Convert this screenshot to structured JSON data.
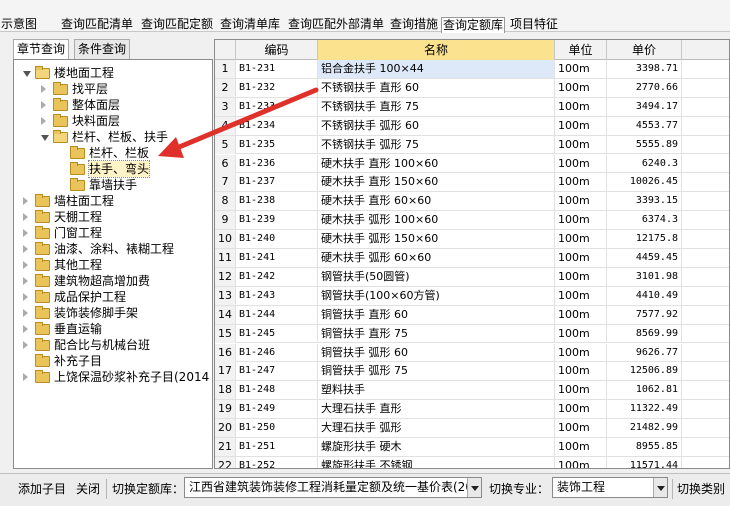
{
  "top_tabs": [
    "示意图",
    "查询匹配清单",
    "查询匹配定额",
    "查询清单库",
    "查询匹配外部清单",
    "查询措施",
    "查询定额库",
    "项目特征"
  ],
  "left_tabs": [
    "章节查询",
    "条件查询"
  ],
  "tree": [
    {
      "label": "楼地面工程",
      "state": "open",
      "level": 0
    },
    {
      "label": "找平层",
      "state": "closed",
      "level": 1
    },
    {
      "label": "整体面层",
      "state": "closed",
      "level": 1
    },
    {
      "label": "块料面层",
      "state": "closed",
      "level": 1
    },
    {
      "label": "栏杆、栏板、扶手",
      "state": "open",
      "level": 1
    },
    {
      "label": "栏杆、栏板",
      "state": "leaf",
      "level": 2
    },
    {
      "label": "扶手、弯头",
      "state": "leaf",
      "level": 2
    },
    {
      "label": "靠墙扶手",
      "state": "leaf",
      "level": 2
    },
    {
      "label": "墙柱面工程",
      "state": "closed",
      "level": 0
    },
    {
      "label": "天棚工程",
      "state": "closed",
      "level": 0
    },
    {
      "label": "门窗工程",
      "state": "closed",
      "level": 0
    },
    {
      "label": "油漆、涂料、裱糊工程",
      "state": "closed",
      "level": 0
    },
    {
      "label": "其他工程",
      "state": "closed",
      "level": 0
    },
    {
      "label": "建筑物超高增加费",
      "state": "closed",
      "level": 0
    },
    {
      "label": "成品保护工程",
      "state": "closed",
      "level": 0
    },
    {
      "label": "装饰装修脚手架",
      "state": "closed",
      "level": 0
    },
    {
      "label": "垂直运输",
      "state": "closed",
      "level": 0
    },
    {
      "label": "配合比与机械台班",
      "state": "closed",
      "level": 0
    },
    {
      "label": "补充子目",
      "state": "leaf",
      "level": 0
    },
    {
      "label": "上饶保温砂浆补充子目(2014",
      "state": "closed",
      "level": 0
    }
  ],
  "grid": {
    "headers": [
      "",
      "编码",
      "名称",
      "单位",
      "单价"
    ],
    "rows": [
      [
        "1",
        "B1-231",
        "铝合金扶手 100×44",
        "100m",
        "3398.71"
      ],
      [
        "2",
        "B1-232",
        "不锈钢扶手 直形 60",
        "100m",
        "2770.66"
      ],
      [
        "3",
        "B1-233",
        "不锈钢扶手 直形 75",
        "100m",
        "3494.17"
      ],
      [
        "4",
        "B1-234",
        "不锈钢扶手 弧形 60",
        "100m",
        "4553.77"
      ],
      [
        "5",
        "B1-235",
        "不锈钢扶手 弧形 75",
        "100m",
        "5555.89"
      ],
      [
        "6",
        "B1-236",
        "硬木扶手 直形 100×60",
        "100m",
        "6240.3"
      ],
      [
        "7",
        "B1-237",
        "硬木扶手 直形 150×60",
        "100m",
        "10026.45"
      ],
      [
        "8",
        "B1-238",
        "硬木扶手 直形 60×60",
        "100m",
        "3393.15"
      ],
      [
        "9",
        "B1-239",
        "硬木扶手 弧形 100×60",
        "100m",
        "6374.3"
      ],
      [
        "10",
        "B1-240",
        "硬木扶手 弧形 150×60",
        "100m",
        "12175.8"
      ],
      [
        "11",
        "B1-241",
        "硬木扶手 弧形 60×60",
        "100m",
        "4459.45"
      ],
      [
        "12",
        "B1-242",
        "钢管扶手(50圆管)",
        "100m",
        "3101.98"
      ],
      [
        "13",
        "B1-243",
        "钢管扶手(100×60方管)",
        "100m",
        "4410.49"
      ],
      [
        "14",
        "B1-244",
        "铜管扶手 直形 60",
        "100m",
        "7577.92"
      ],
      [
        "15",
        "B1-245",
        "铜管扶手 直形 75",
        "100m",
        "8569.99"
      ],
      [
        "16",
        "B1-246",
        "铜管扶手 弧形 60",
        "100m",
        "9626.77"
      ],
      [
        "17",
        "B1-247",
        "铜管扶手 弧形 75",
        "100m",
        "12506.89"
      ],
      [
        "18",
        "B1-248",
        "塑料扶手",
        "100m",
        "1062.81"
      ],
      [
        "19",
        "B1-249",
        "大理石扶手 直形",
        "100m",
        "11322.49"
      ],
      [
        "20",
        "B1-250",
        "大理石扶手 弧形",
        "100m",
        "21482.99"
      ],
      [
        "21",
        "B1-251",
        "螺旋形扶手 硬木",
        "100m",
        "8955.85"
      ],
      [
        "22",
        "B1-252",
        "螺旋形扶手 不锈钢",
        "100m",
        "11571.44"
      ]
    ]
  },
  "bottom": {
    "add_sub": "添加子目",
    "close": "关闭",
    "switch_lib_label": "切换定额库：",
    "switch_lib_value": "江西省建筑装饰装修工程消耗量定额及统一基价表(20",
    "switch_major_label": "切换专业：",
    "switch_major_value": "装饰工程",
    "switch_category": "切换类别"
  },
  "colors": {
    "arrow": "#e0302a",
    "header_highlight": "#fbe28e",
    "folder": "#e9c45a"
  }
}
